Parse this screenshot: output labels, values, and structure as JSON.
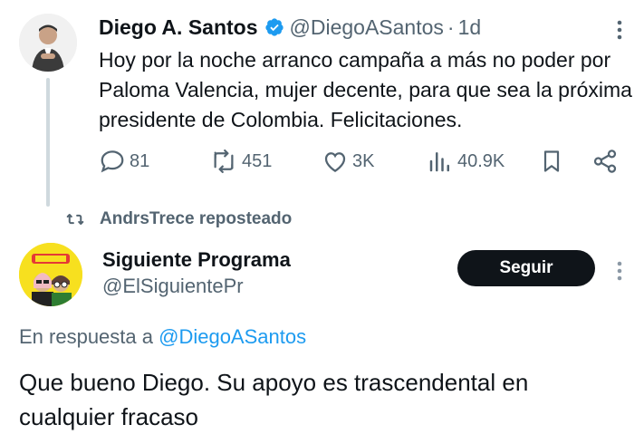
{
  "tweet": {
    "author_name": "Diego A. Santos",
    "handle": "@DiegoASantos",
    "separator": "·",
    "time": "1d",
    "text": "Hoy por la noche arranco campaña a más no poder por Paloma Valencia, mujer decente, para que sea la próxima presidente de Colombia. Felicitaciones.",
    "verified_icon": "verified-badge-icon",
    "actions": {
      "replies": "81",
      "reposts": "451",
      "likes": "3K",
      "views": "40.9K"
    }
  },
  "repost_banner": {
    "text": "AndrsTrece reposteado",
    "icon": "repost-icon"
  },
  "reply": {
    "author_name": "Siguiente Programa",
    "handle": "@ElSiguientePr",
    "follow_label": "Seguir",
    "reply_prefix": "En respuesta a",
    "reply_mention": "@DiegoASantos",
    "text": "Que bueno Diego. Su apoyo es trascendental en cualquier fracaso"
  },
  "colors": {
    "text": "#0f1419",
    "secondary": "#536471",
    "link": "#1d9bf0",
    "verified": "#1d9bf0",
    "follow_bg": "#0f1419",
    "thread_line": "#cfd9de"
  }
}
